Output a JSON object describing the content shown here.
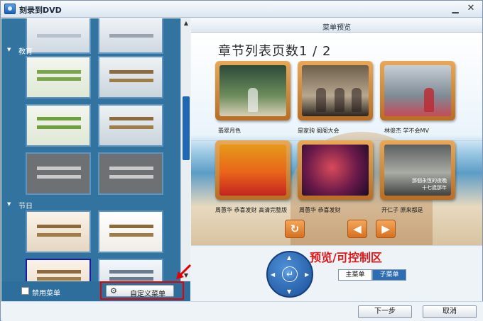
{
  "window": {
    "title": "刻录到DVD"
  },
  "colors": {
    "accent": "#2f6db2",
    "highlight_frame": "#e60000",
    "annotation": "#e01818"
  },
  "left_panel": {
    "categories": [
      {
        "label": "教育"
      },
      {
        "label": "节日"
      }
    ],
    "disable_menu_label": "禁用菜单",
    "custom_menu_label": "自定义菜单"
  },
  "preview": {
    "header": "菜单预览",
    "page_title": "章节列表页数1 / 2",
    "thumbnails": [
      {
        "label": "翡翠月色"
      },
      {
        "label": "是家驹 阁阁大会"
      },
      {
        "label": "林俊杰 学不会MV"
      },
      {
        "label": "周蕙华 恭喜发财 高清完整版"
      },
      {
        "label": "周蕙华 恭喜发财"
      },
      {
        "label": "开仁子 原来都是"
      }
    ],
    "thumb6_caption": "那個永恆的夜晚",
    "thumb6_caption2": "十七歲那年",
    "annotation": "预览/可控制区",
    "tabs": {
      "main": "主菜单",
      "sub": "子菜单"
    }
  },
  "icons": {
    "loop": "loop-icon",
    "left": "arrow-left-icon",
    "right": "arrow-right-icon",
    "enter": "enter-icon",
    "gear": "gear-icon"
  },
  "footer": {
    "next": "下一步",
    "cancel": "取消"
  }
}
